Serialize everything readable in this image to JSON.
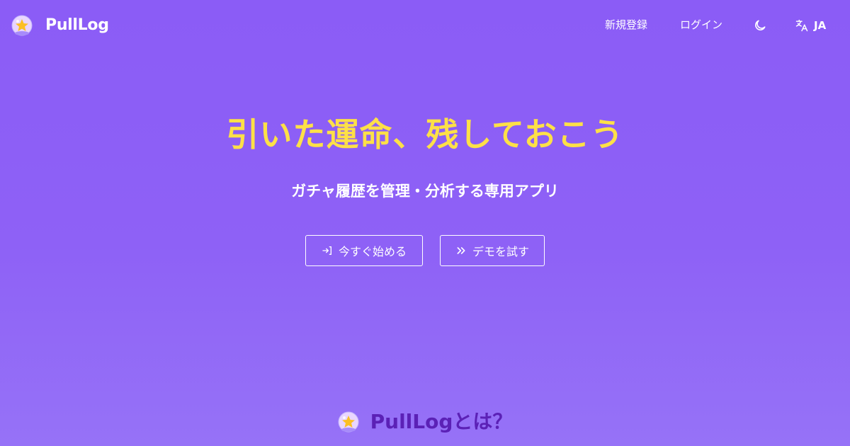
{
  "header": {
    "brand": "PullLog",
    "signup_label": "新規登録",
    "login_label": "ログイン",
    "language_label": "JA",
    "theme_icon": "moon-icon",
    "language_icon": "translate-icon",
    "logo_icon": "crystal-ball-star-icon"
  },
  "hero": {
    "title": "引いた運命、残しておこう",
    "subtitle": "ガチャ履歴を管理・分析する専用アプリ",
    "start_button": {
      "label": "今すぐ始める",
      "icon": "login-arrow-icon"
    },
    "demo_button": {
      "label": "デモを試す",
      "icon": "double-chevron-right-icon"
    }
  },
  "about": {
    "heading": "PullLogとは？"
  },
  "colors": {
    "background": "#8b5cf6",
    "title": "#fde047",
    "about_heading": "#5b21b6",
    "text": "#ffffff"
  }
}
